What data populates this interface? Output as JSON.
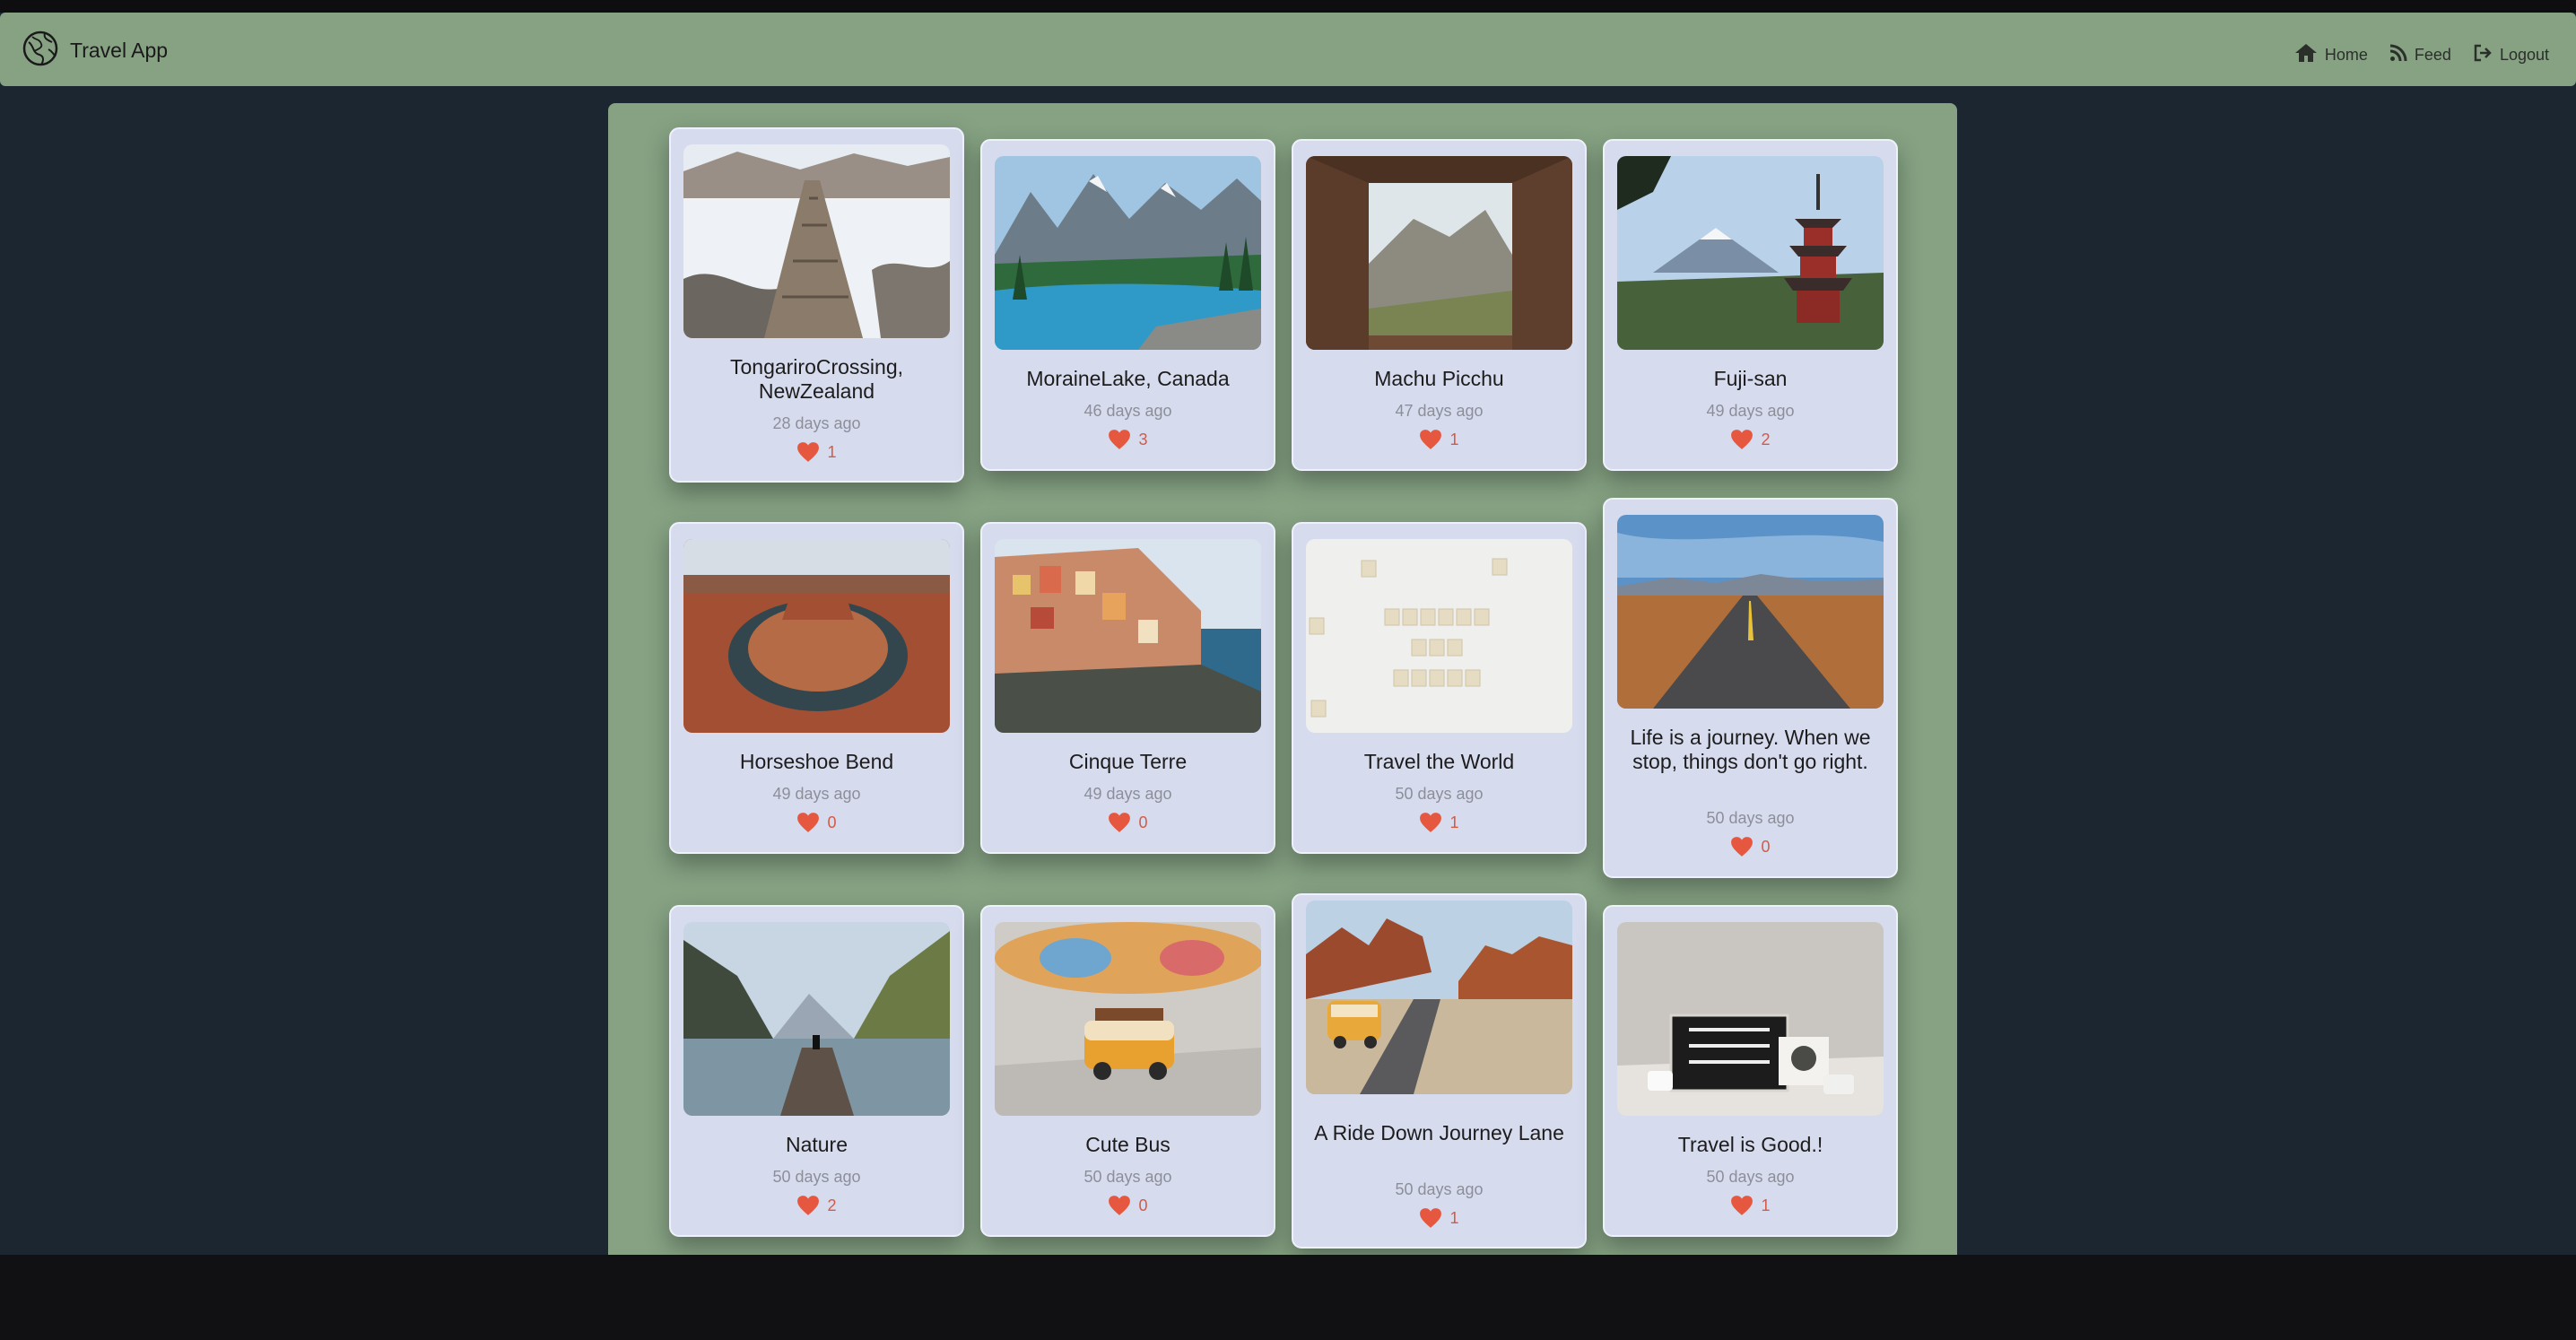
{
  "navbar": {
    "title": "Travel App",
    "links": [
      {
        "label": "Home",
        "icon": "home-icon"
      },
      {
        "label": "Feed",
        "icon": "rss-icon"
      },
      {
        "label": "Logout",
        "icon": "logout-icon"
      }
    ]
  },
  "colors": {
    "navbar": "#86a283",
    "page_background": "#1c2630",
    "card_background": "#d7dbee",
    "heart": "#e5573f"
  },
  "posts": [
    {
      "title": "TongariroCrossing, NewZealand",
      "date": "28 days ago",
      "likes": "1",
      "image": "snowy-boardwalk-photo"
    },
    {
      "title": "MoraineLake, Canada",
      "date": "46 days ago",
      "likes": "3",
      "image": "mountain-lake-photo"
    },
    {
      "title": "Machu Picchu",
      "date": "47 days ago",
      "likes": "1",
      "image": "stone-window-ruins-photo"
    },
    {
      "title": "Fuji-san",
      "date": "49 days ago",
      "likes": "2",
      "image": "pagoda-mount-fuji-photo"
    },
    {
      "title": "Horseshoe Bend",
      "date": "49 days ago",
      "likes": "0",
      "image": "canyon-river-bend-photo"
    },
    {
      "title": "Cinque Terre",
      "date": "49 days ago",
      "likes": "0",
      "image": "coastal-village-photo"
    },
    {
      "title": "Travel the World",
      "date": "50 days ago",
      "likes": "1",
      "image": "scrabble-tiles-photo"
    },
    {
      "title": "Life is a journey. When we stop, things don't go right.",
      "date": "50 days ago",
      "likes": "0",
      "image": "desert-highway-photo"
    },
    {
      "title": "Nature",
      "date": "50 days ago",
      "likes": "2",
      "image": "fjord-dock-photo"
    },
    {
      "title": "Cute Bus",
      "date": "50 days ago",
      "likes": "0",
      "image": "toy-van-photo"
    },
    {
      "title": "A Ride Down Journey Lane",
      "date": "50 days ago",
      "likes": "1",
      "image": "van-desert-road-photo"
    },
    {
      "title": "Travel is Good.!",
      "date": "50 days ago",
      "likes": "1",
      "image": "letter-board-photo"
    }
  ]
}
